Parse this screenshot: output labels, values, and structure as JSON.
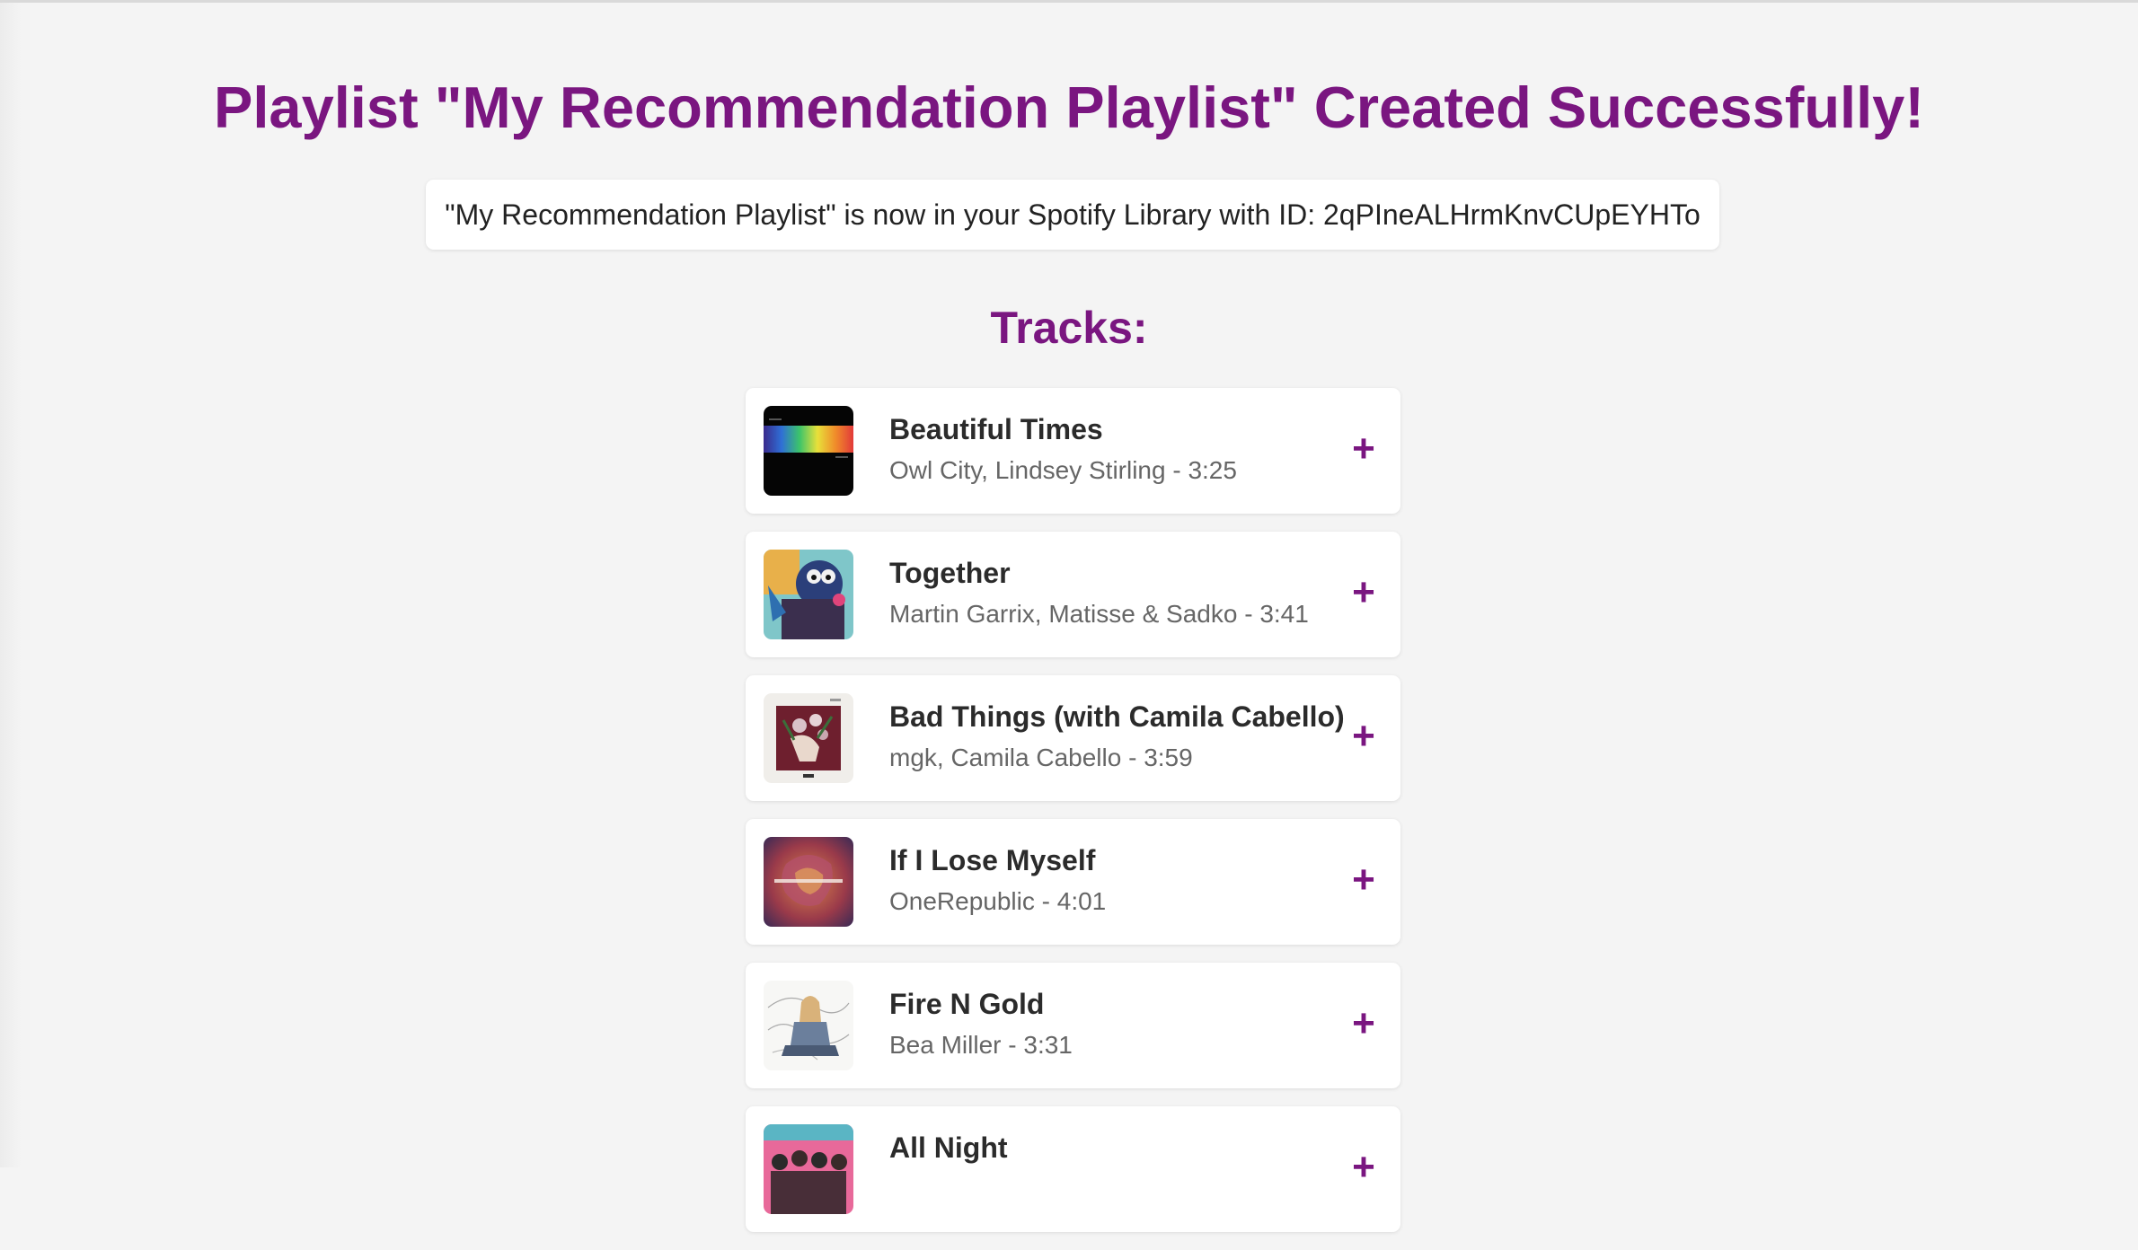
{
  "page": {
    "title": "Playlist \"My Recommendation Playlist\" Created Successfully!",
    "notice": "\"My Recommendation Playlist\" is now in your Spotify Library with ID: 2qPIneALHrmKnvCUpEYHTo",
    "tracks_heading": "Tracks:"
  },
  "colors": {
    "accent": "#7a1680",
    "background": "#f4f4f4",
    "card": "#ffffff",
    "title_text": "#2b2b2b",
    "meta_text": "#666666"
  },
  "tracks": [
    {
      "title": "Beautiful Times",
      "meta": "Owl City, Lindsey Stirling - 3:25",
      "add_label": "+",
      "cover": "beautiful-times-cover"
    },
    {
      "title": "Together",
      "meta": "Martin Garrix, Matisse & Sadko - 3:41",
      "add_label": "+",
      "cover": "together-cover"
    },
    {
      "title": "Bad Things (with Camila Cabello)",
      "meta": "mgk, Camila Cabello - 3:59",
      "add_label": "+",
      "cover": "bad-things-cover"
    },
    {
      "title": "If I Lose Myself",
      "meta": "OneRepublic - 4:01",
      "add_label": "+",
      "cover": "if-i-lose-myself-cover"
    },
    {
      "title": "Fire N Gold",
      "meta": "Bea Miller - 3:31",
      "add_label": "+",
      "cover": "fire-n-gold-cover"
    },
    {
      "title": "All Night",
      "meta": "",
      "add_label": "+",
      "cover": "all-night-cover"
    }
  ]
}
